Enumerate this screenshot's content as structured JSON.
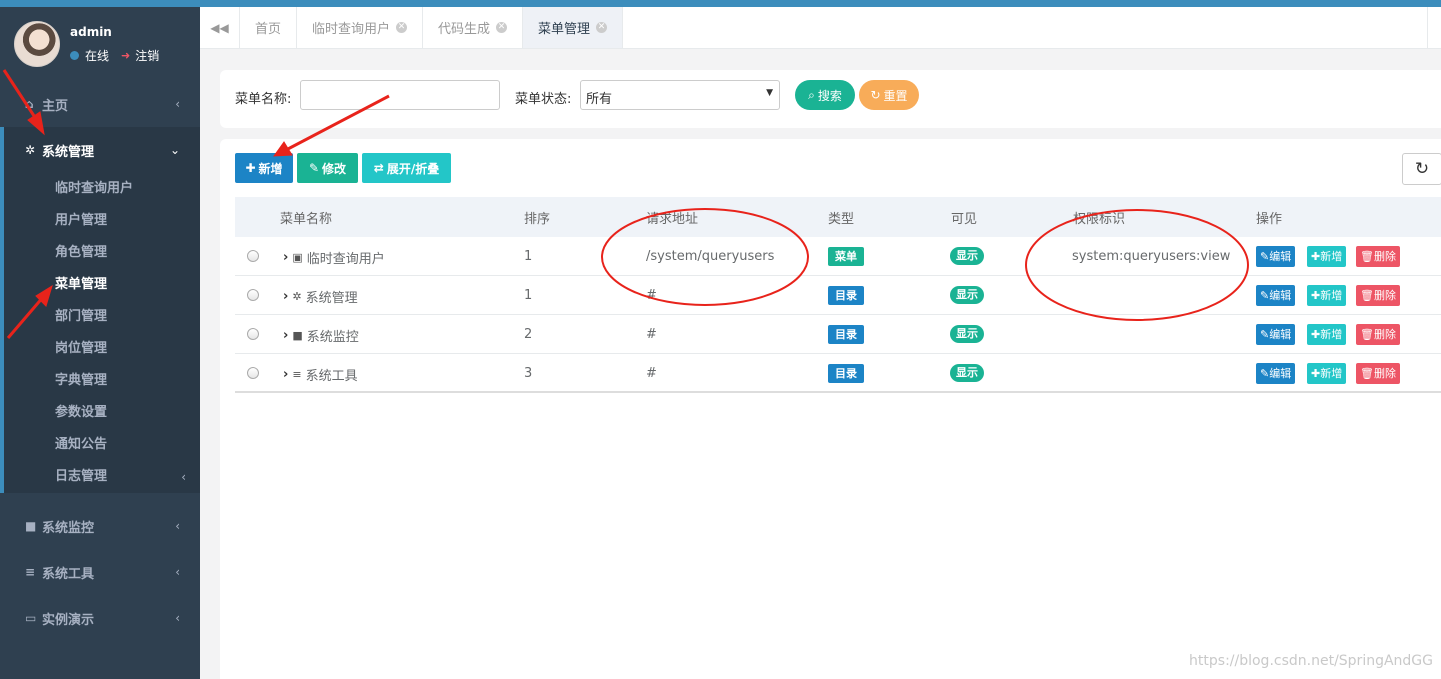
{
  "user": {
    "name": "admin",
    "status": "在线",
    "logout": "注销"
  },
  "sidebar": {
    "home": "主页",
    "system": "系统管理",
    "sub_items": [
      "临时查询用户",
      "用户管理",
      "角色管理",
      "菜单管理",
      "部门管理",
      "岗位管理",
      "字典管理",
      "参数设置",
      "通知公告",
      "日志管理"
    ],
    "monitor": "系统监控",
    "tools": "系统工具",
    "demo": "实例演示"
  },
  "tabs": [
    {
      "label": "首页",
      "closable": false
    },
    {
      "label": "临时查询用户",
      "closable": true
    },
    {
      "label": "代码生成",
      "closable": true
    },
    {
      "label": "菜单管理",
      "closable": true,
      "active": true
    }
  ],
  "search": {
    "name_label": "菜单名称:",
    "name_value": "",
    "status_label": "菜单状态:",
    "status_value": "所有",
    "search_btn": "搜索",
    "reset_btn": "重置"
  },
  "toolbar": {
    "add": "新增",
    "edit": "修改",
    "expand": "展开/折叠"
  },
  "table": {
    "headers": [
      "菜单名称",
      "排序",
      "请求地址",
      "类型",
      "可见",
      "权限标识",
      "操作"
    ],
    "rows": [
      {
        "name": "临时查询用户",
        "icon": "id-card-icon",
        "order": "1",
        "url": "/system/queryusers",
        "type": "菜单",
        "type_color": "#1ab394",
        "visible": "显示",
        "perms": "system:queryusers:view"
      },
      {
        "name": "系统管理",
        "icon": "gear-icon",
        "order": "1",
        "url": "#",
        "type": "目录",
        "type_color": "#1c84c6",
        "visible": "显示",
        "perms": ""
      },
      {
        "name": "系统监控",
        "icon": "video-icon",
        "order": "2",
        "url": "#",
        "type": "目录",
        "type_color": "#1c84c6",
        "visible": "显示",
        "perms": ""
      },
      {
        "name": "系统工具",
        "icon": "bars-icon",
        "order": "3",
        "url": "#",
        "type": "目录",
        "type_color": "#1c84c6",
        "visible": "显示",
        "perms": ""
      }
    ],
    "actions": {
      "edit": "编辑",
      "add": "新增",
      "delete": "删除"
    }
  },
  "colors": {
    "primary": "#1c84c6",
    "success": "#1ab394",
    "info": "#23c6c8",
    "warning": "#f8ac59",
    "danger": "#ed5565",
    "sidebar": "#2f4050",
    "annotation": "#e8231b"
  },
  "watermark": "https://blog.csdn.net/SpringAndGG"
}
